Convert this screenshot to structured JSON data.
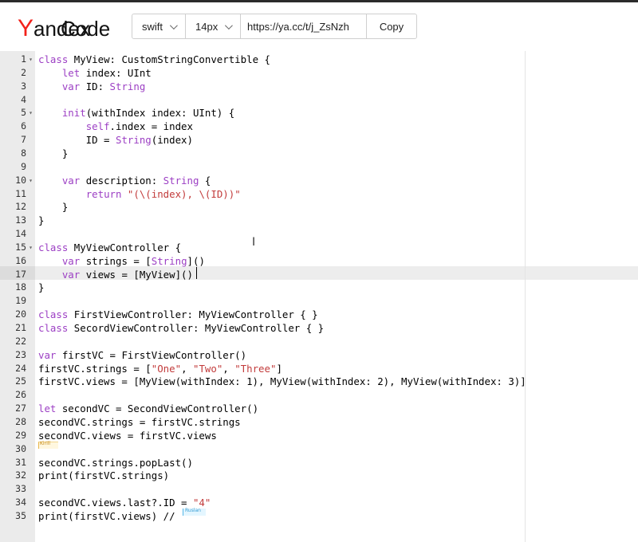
{
  "header": {
    "logo_y": "Y",
    "logo_andex": "andex",
    "logo_code": "Code",
    "language": "swift",
    "font_size": "14px",
    "share_url": "https://ya.cc/t/j_ZsNzh",
    "copy_label": "Copy"
  },
  "editor": {
    "active_line": 17,
    "cursor_tags": {
      "kirill": "Kirill",
      "ruslan": "Ruslan"
    },
    "lines": [
      {
        "n": "1",
        "fold": true,
        "tokens": [
          [
            "kw",
            "class"
          ],
          [
            "t",
            " MyView: CustomStringConvertible {"
          ]
        ]
      },
      {
        "n": "2",
        "tokens": [
          [
            "t",
            "    "
          ],
          [
            "kw",
            "let"
          ],
          [
            "t",
            " index: UInt"
          ]
        ]
      },
      {
        "n": "3",
        "tokens": [
          [
            "t",
            "    "
          ],
          [
            "kw",
            "var"
          ],
          [
            "t",
            " ID: "
          ],
          [
            "ty",
            "String"
          ]
        ]
      },
      {
        "n": "4",
        "tokens": []
      },
      {
        "n": "5",
        "fold": true,
        "tokens": [
          [
            "t",
            "    "
          ],
          [
            "kw",
            "init"
          ],
          [
            "t",
            "(withIndex index: UInt) {"
          ]
        ]
      },
      {
        "n": "6",
        "tokens": [
          [
            "t",
            "        "
          ],
          [
            "kw",
            "self"
          ],
          [
            "t",
            ".index = index"
          ]
        ]
      },
      {
        "n": "7",
        "tokens": [
          [
            "t",
            "        ID = "
          ],
          [
            "ty",
            "String"
          ],
          [
            "t",
            "(index)"
          ]
        ]
      },
      {
        "n": "8",
        "tokens": [
          [
            "t",
            "    }"
          ]
        ]
      },
      {
        "n": "9",
        "tokens": []
      },
      {
        "n": "10",
        "fold": true,
        "tokens": [
          [
            "t",
            "    "
          ],
          [
            "kw",
            "var"
          ],
          [
            "t",
            " description: "
          ],
          [
            "ty",
            "String"
          ],
          [
            "t",
            " {"
          ]
        ]
      },
      {
        "n": "11",
        "tokens": [
          [
            "t",
            "        "
          ],
          [
            "kw",
            "return"
          ],
          [
            "t",
            " "
          ],
          [
            "str",
            "\"(\\(index), \\(ID))\""
          ]
        ]
      },
      {
        "n": "12",
        "tokens": [
          [
            "t",
            "    }"
          ]
        ]
      },
      {
        "n": "13",
        "tokens": [
          [
            "t",
            "}"
          ]
        ]
      },
      {
        "n": "14",
        "tokens": []
      },
      {
        "n": "15",
        "fold": true,
        "tokens": [
          [
            "kw",
            "class"
          ],
          [
            "t",
            " MyViewController {"
          ]
        ]
      },
      {
        "n": "16",
        "tokens": [
          [
            "t",
            "    "
          ],
          [
            "kw",
            "var"
          ],
          [
            "t",
            " strings = ["
          ],
          [
            "ty",
            "String"
          ],
          [
            "t",
            "]()"
          ]
        ]
      },
      {
        "n": "17",
        "tokens": [
          [
            "t",
            "    "
          ],
          [
            "kw",
            "var"
          ],
          [
            "t",
            " views = [MyView]()"
          ]
        ]
      },
      {
        "n": "18",
        "tokens": [
          [
            "t",
            "}"
          ]
        ]
      },
      {
        "n": "19",
        "tokens": []
      },
      {
        "n": "20",
        "tokens": [
          [
            "kw",
            "class"
          ],
          [
            "t",
            " FirstViewController: MyViewController { }"
          ]
        ]
      },
      {
        "n": "21",
        "tokens": [
          [
            "kw",
            "class"
          ],
          [
            "t",
            " SecordViewController: MyViewController { }"
          ]
        ]
      },
      {
        "n": "22",
        "tokens": []
      },
      {
        "n": "23",
        "tokens": [
          [
            "kw",
            "var"
          ],
          [
            "t",
            " firstVC = FirstViewController()"
          ]
        ]
      },
      {
        "n": "24",
        "tokens": [
          [
            "t",
            "firstVC.strings = ["
          ],
          [
            "str",
            "\"One\""
          ],
          [
            "t",
            ", "
          ],
          [
            "str",
            "\"Two\""
          ],
          [
            "t",
            ", "
          ],
          [
            "str",
            "\"Three\""
          ],
          [
            "t",
            "]"
          ]
        ]
      },
      {
        "n": "25",
        "tokens": [
          [
            "t",
            "firstVC.views = [MyView(withIndex: 1), MyView(withIndex: 2), MyView(withIndex: 3)]"
          ]
        ]
      },
      {
        "n": "26",
        "tokens": []
      },
      {
        "n": "27",
        "tokens": [
          [
            "kw",
            "let"
          ],
          [
            "t",
            " secondVC = SecondViewController()"
          ]
        ]
      },
      {
        "n": "28",
        "tokens": [
          [
            "t",
            "secondVC.strings = firstVC.strings"
          ]
        ]
      },
      {
        "n": "29",
        "tokens": [
          [
            "t",
            "secondVC.views = firstVC.views"
          ]
        ]
      },
      {
        "n": "30",
        "tokens": []
      },
      {
        "n": "31",
        "tokens": [
          [
            "t",
            "secondVC.strings.popLast()"
          ]
        ]
      },
      {
        "n": "32",
        "tokens": [
          [
            "t",
            "print(firstVC.strings)"
          ]
        ]
      },
      {
        "n": "33",
        "tokens": []
      },
      {
        "n": "34",
        "tokens": [
          [
            "t",
            "secondVC.views.last?.ID = "
          ],
          [
            "str",
            "\"4\""
          ]
        ]
      },
      {
        "n": "35",
        "tokens": [
          [
            "t",
            "print(firstVC.views) // "
          ]
        ]
      }
    ]
  },
  "colors": {
    "keyword": "#9c3fc4",
    "string": "#c23b3b",
    "logo_accent": "#f2211a"
  }
}
